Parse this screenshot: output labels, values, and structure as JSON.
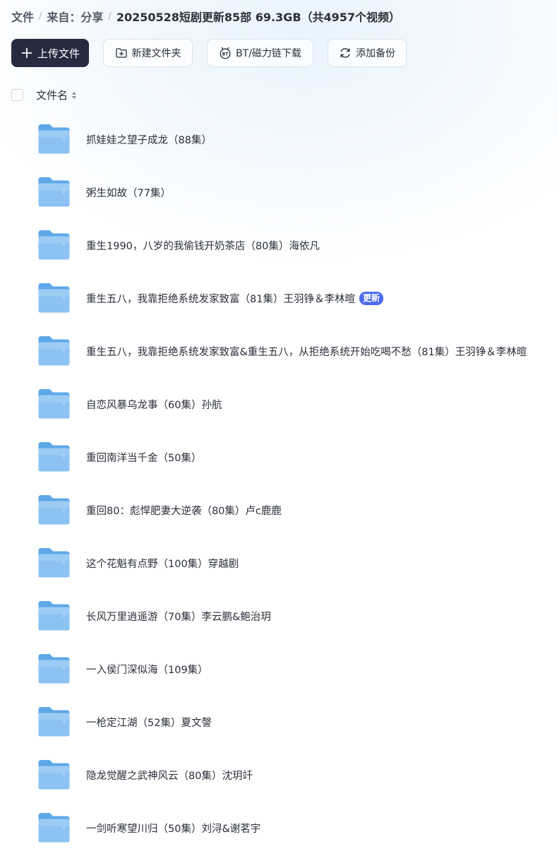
{
  "breadcrumb": {
    "items": [
      "文件",
      "来自：分享",
      "20250528短剧更新85部 69.3GB（共4957个视频）"
    ],
    "separator": "/"
  },
  "toolbar": {
    "upload_label": "上传文件",
    "new_folder_label": "新建文件夹",
    "bt_label": "BT/磁力链下载",
    "backup_label": "添加备份"
  },
  "list_header": {
    "name_column": "文件名"
  },
  "folders": [
    {
      "name": "抓娃娃之望子成龙（88集）"
    },
    {
      "name": "粥生如故（77集）"
    },
    {
      "name": "重生1990，八岁的我偷钱开奶茶店（80集）海依凡"
    },
    {
      "name": "重生五八，我靠拒绝系统发家致富（81集）王羽铮＆李林暄",
      "badge": "更新"
    },
    {
      "name": "重生五八，我靠拒绝系统发家致富&重生五八，从拒绝系统开始吃喝不愁（81集）王羽铮＆李林暄"
    },
    {
      "name": "自恋风暴乌龙事（60集）孙航"
    },
    {
      "name": "重回南洋当千金（50集）"
    },
    {
      "name": "重回80：彪悍肥妻大逆袭（80集）卢c鹿鹿"
    },
    {
      "name": "这个花魁有点野（100集）穿越剧"
    },
    {
      "name": "长风万里逍遥游（70集）李云鹏&鲍治玥"
    },
    {
      "name": "一入侯门深似海（109集）"
    },
    {
      "name": "一枪定江湖（52集）夏文謦"
    },
    {
      "name": "隐龙觉醒之武神风云（80集）沈玥竏"
    },
    {
      "name": "一剑听寒望川归（50集）刘浔&谢茗宇"
    }
  ],
  "colors": {
    "primary_button": "#262b3f",
    "badge": "#4d6bf0",
    "folder": "#8cc2f2"
  }
}
